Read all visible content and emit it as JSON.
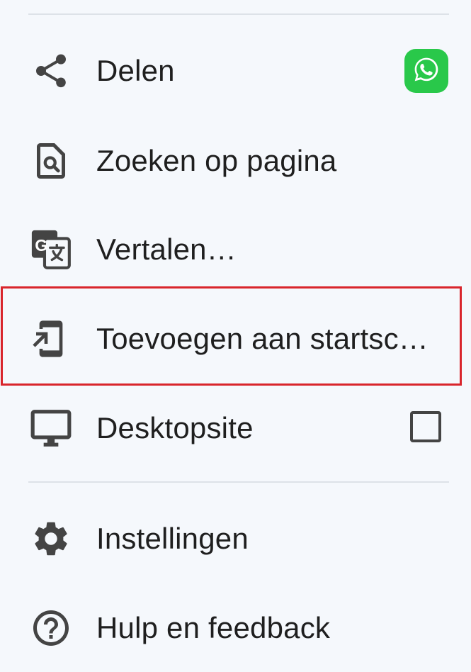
{
  "menu": {
    "items": [
      {
        "label": "Delen",
        "icon": "share-icon"
      },
      {
        "label": "Zoeken op pagina",
        "icon": "find-in-page-icon"
      },
      {
        "label": "Vertalen…",
        "icon": "translate-icon"
      },
      {
        "label": "Toevoegen aan startsc…",
        "icon": "add-to-home-screen-icon"
      },
      {
        "label": "Desktopsite",
        "icon": "desktop-icon"
      },
      {
        "label": "Instellingen",
        "icon": "gear-icon"
      },
      {
        "label": "Hulp en feedback",
        "icon": "help-icon"
      }
    ],
    "share_app": "whatsapp-icon",
    "desktop_site_checked": false
  },
  "colors": {
    "background": "#f5f8fc",
    "highlight_border": "#d9252c",
    "whatsapp_green": "#29c84a",
    "icon": "#444444",
    "text": "#1f1f1f"
  }
}
